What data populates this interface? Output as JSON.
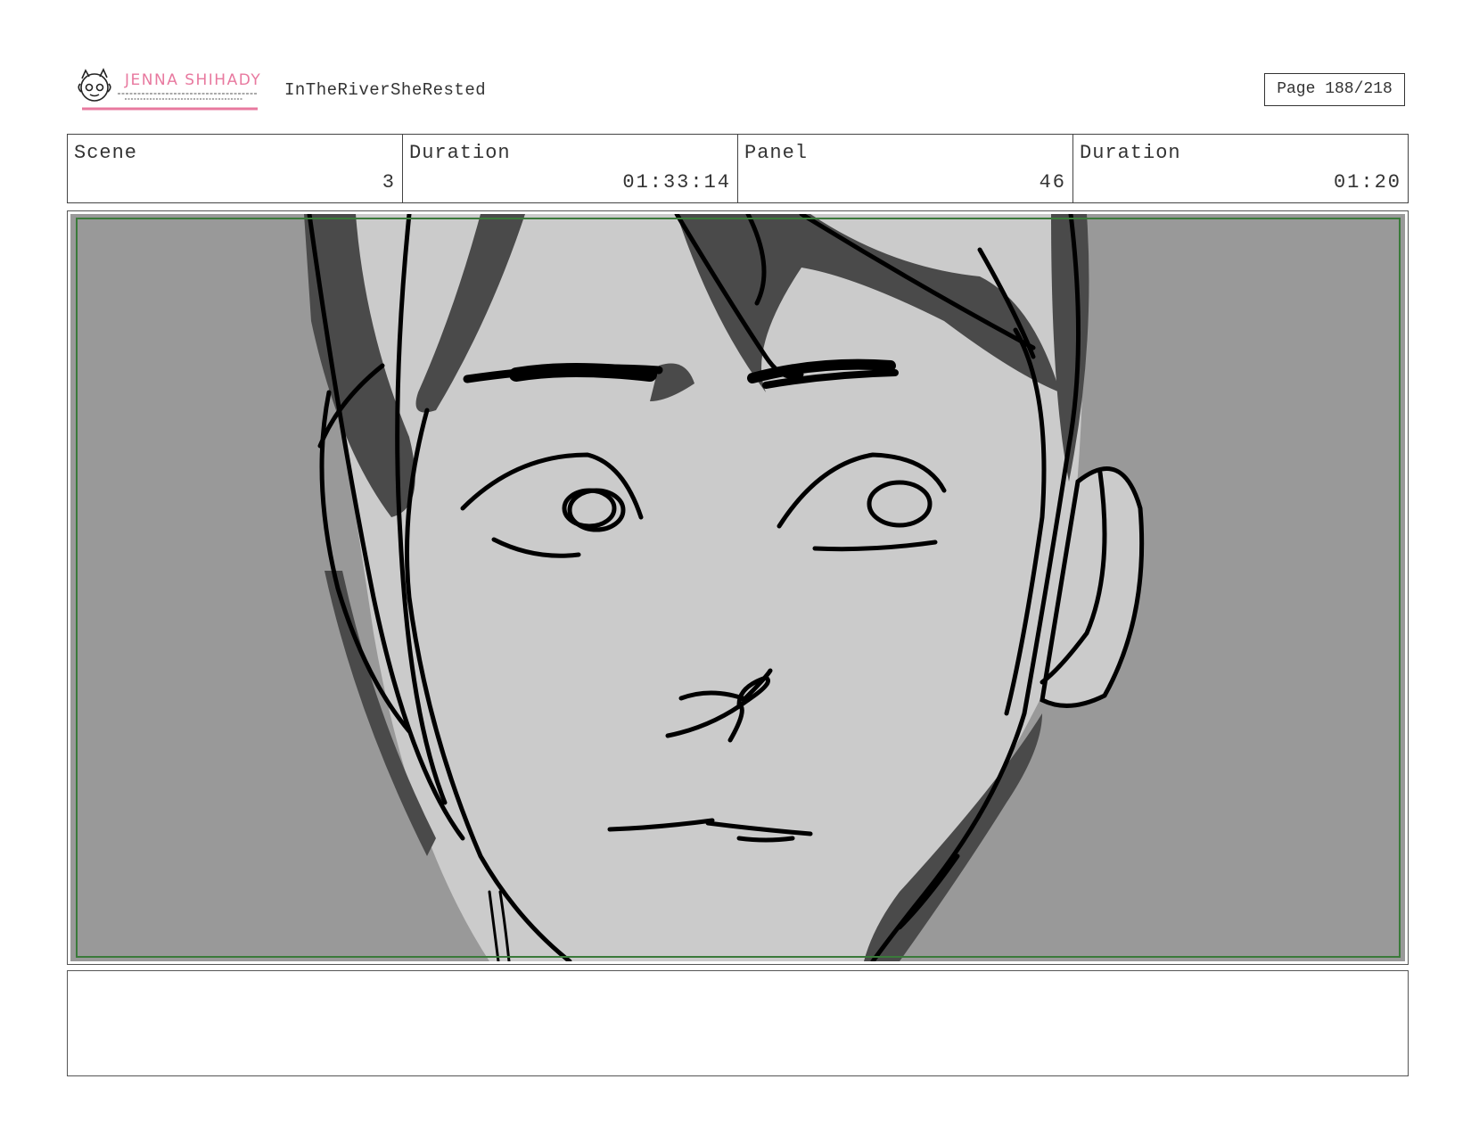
{
  "header": {
    "logo": {
      "brand_name": "JENNA SHIHADY",
      "icon": "character-face-logo-icon",
      "accent_color": "#e8799f"
    },
    "project_title": "InTheRiverSheRested",
    "page_label": "Page 188/218"
  },
  "info": {
    "scene_label": "Scene",
    "scene_value": "3",
    "scene_duration_label": "Duration",
    "scene_duration_value": "01:33:14",
    "panel_label": "Panel",
    "panel_value": "46",
    "panel_duration_label": "Duration",
    "panel_duration_value": "01:20"
  },
  "panel": {
    "image": "storyboard-sketch-closeup-face",
    "safe_area_color": "#3a7a3a",
    "background_color": "#999999",
    "skin_color": "#cbcbcb",
    "shadow_color": "#4a4a4a",
    "line_color": "#000000"
  },
  "notes": {
    "text": ""
  }
}
